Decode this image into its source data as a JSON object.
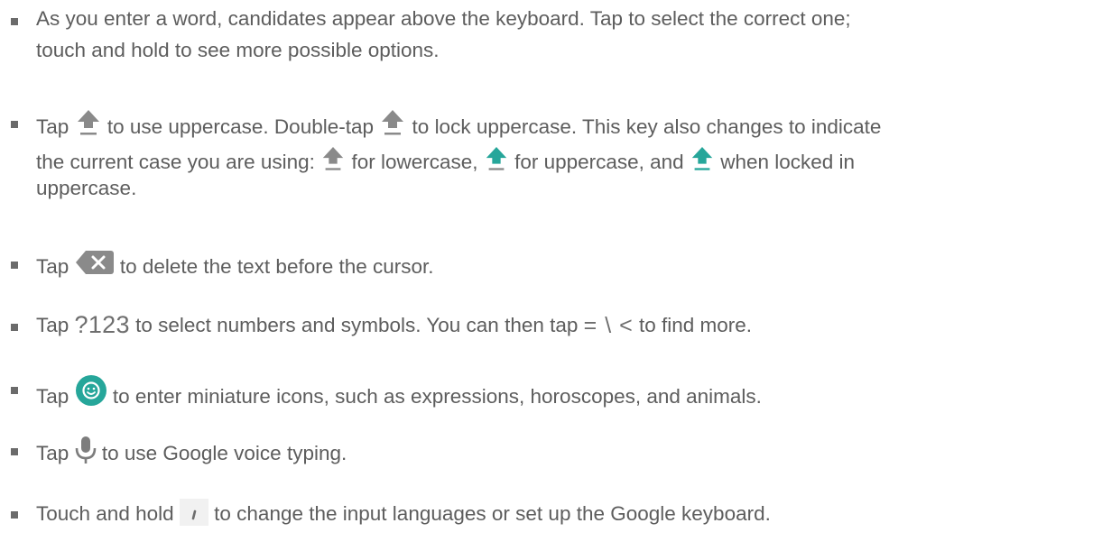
{
  "items": [
    {
      "lines": [
        "As you enter a word, candidates appear above the keyboard. Tap to select the correct one;",
        "touch and hold to see more possible options."
      ]
    },
    {
      "l1a": "Tap",
      "l1b": "to use uppercase. Double-tap",
      "l1c": "to lock uppercase. This key also changes to indicate",
      "l2a": "the current case you are using:",
      "l2b": "for lowercase,",
      "l2c": "for uppercase, and",
      "l2d": "when locked in",
      "l3": "uppercase."
    },
    {
      "a": "Tap",
      "b": "to delete the text before the cursor."
    },
    {
      "a": "Tap",
      "key": "?123",
      "b": "to select numbers and symbols. You can then tap",
      "sym": "= \\ <",
      "c": "to find more."
    },
    {
      "a": "Tap",
      "b": "to enter miniature icons, such as expressions, horoscopes, and animals."
    },
    {
      "a": "Tap",
      "b": "to use Google voice typing."
    },
    {
      "a": "Touch and hold",
      "b": "to change the input languages or set up the Google keyboard."
    }
  ],
  "icons": {
    "shift_off": "shift-arrow-gray",
    "shift_on": "shift-arrow-teal",
    "delete": "backspace-key",
    "emoji": "emoji-smiley",
    "mic": "microphone",
    "comma": "comma-key"
  },
  "colors": {
    "text": "#5d5d5d",
    "teal": "#26a69a",
    "gray_icon": "#8a8a8a"
  }
}
